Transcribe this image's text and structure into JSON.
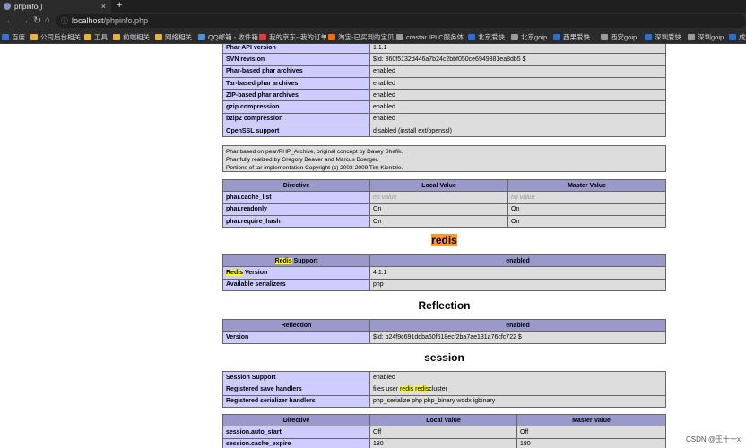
{
  "tab": {
    "title": "phpinfo()",
    "close": "×",
    "new_tab": "+"
  },
  "address": {
    "host": "localhost",
    "path": "/phpinfo.php"
  },
  "bookmarks": [
    {
      "label": "百度",
      "color": "#3b6fe0"
    },
    {
      "label": "公司后台相关",
      "color": "#e7b43a"
    },
    {
      "label": "工具",
      "color": "#e7b43a"
    },
    {
      "label": "前端相关",
      "color": "#e7b43a"
    },
    {
      "label": "网络相关",
      "color": "#e7b43a"
    },
    {
      "label": "QQ邮箱 - 收件箱",
      "color": "#4a90d9"
    },
    {
      "label": "我的京东--我的订单",
      "color": "#e23a3a"
    },
    {
      "label": "淘宝-已买到的宝贝",
      "color": "#ff6a00"
    },
    {
      "label": "crastar IPLC服务体...",
      "color": "#9a9a9a"
    },
    {
      "label": "北京爱快",
      "color": "#2a6fd6"
    },
    {
      "label": "北京goip",
      "color": "#9a9a9a"
    },
    {
      "label": "西果爱快",
      "color": "#2a6fd6"
    },
    {
      "label": "西安goip",
      "color": "#9a9a9a"
    },
    {
      "label": "深圳爱快",
      "color": "#2a6fd6"
    },
    {
      "label": "深圳goip",
      "color": "#9a9a9a"
    },
    {
      "label": "成都",
      "color": "#2a6fd6"
    }
  ],
  "phar": {
    "rows": [
      {
        "key": "Phar API version",
        "value": "1.1.1"
      },
      {
        "key": "SVN revision",
        "value": "$Id: 860f5132d446a7b24c2bbf050ce6949381ea8db5 $"
      },
      {
        "key": "Phar-based phar archives",
        "value": "enabled"
      },
      {
        "key": "Tar-based phar archives",
        "value": "enabled"
      },
      {
        "key": "ZIP-based phar archives",
        "value": "enabled"
      },
      {
        "key": "gzip compression",
        "value": "enabled"
      },
      {
        "key": "bzip2 compression",
        "value": "enabled"
      },
      {
        "key": "OpenSSL support",
        "value": "disabled (install ext/openssl)"
      }
    ],
    "note": [
      "Phar based on pear/PHP_Archive, original concept by Davey Shafik.",
      "Phar fully realized by Gregory Beaver and Marcus Boerger.",
      "Portions of tar implementation Copyright (c) 2003-2009 Tim Kientzle."
    ],
    "directives_header": [
      "Directive",
      "Local Value",
      "Master Value"
    ],
    "directives": [
      {
        "name": "phar.cache_list",
        "local": "no value",
        "master": "no value"
      },
      {
        "name": "phar.readonly",
        "local": "On",
        "master": "On"
      },
      {
        "name": "phar.require_hash",
        "local": "On",
        "master": "On"
      }
    ]
  },
  "redis": {
    "title": "redis",
    "support_prefix": "Redis",
    "support_suffix": " Support",
    "support_value": "enabled",
    "version_prefix": "Redis",
    "version_suffix": " Version",
    "version_value": "4.1.1",
    "serializers_label": "Available serializers",
    "serializers_value": "php"
  },
  "reflection": {
    "title": "Reflection",
    "header": [
      "Reflection",
      "enabled"
    ],
    "version_label": "Version",
    "version_value": "$Id: b24f9c691ddba60f618ecf2ba7ae131a76cfc722 $"
  },
  "session": {
    "title": "session",
    "rows": [
      {
        "key": "Session Support",
        "value": "enabled"
      },
      {
        "key": "Registered save handlers",
        "value_prefix": "files user ",
        "hl1": "redis",
        "hl_sep": " ",
        "hl2": "redis",
        "value_suffix": "cluster"
      },
      {
        "key": "Registered serializer handlers",
        "value": "php_serialize php php_binary wddx igbinary"
      }
    ],
    "directives_header": [
      "Directive",
      "Local Value",
      "Master Value"
    ],
    "directives": [
      {
        "name": "session.auto_start",
        "local": "Off",
        "master": "Off"
      },
      {
        "name": "session.cache_expire",
        "local": "180",
        "master": "180"
      }
    ]
  },
  "watermark": "CSDN @王十一x"
}
